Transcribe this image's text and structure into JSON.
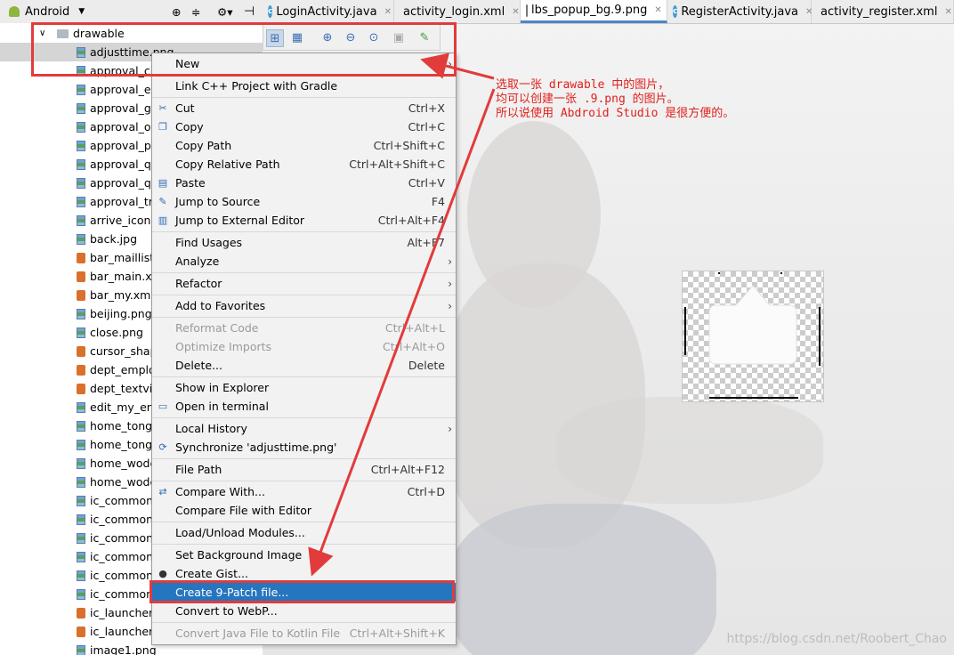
{
  "project_pane": {
    "view_label": "Android",
    "folder": "drawable",
    "files": [
      {
        "name": "adjusttime.png",
        "type": "png",
        "selected": true
      },
      {
        "name": "approval_cli",
        "type": "png"
      },
      {
        "name": "approval_en",
        "type": "png"
      },
      {
        "name": "approval_gc",
        "type": "png"
      },
      {
        "name": "approval_ov",
        "type": "png"
      },
      {
        "name": "approval_pr",
        "type": "png"
      },
      {
        "name": "approval_qi",
        "type": "png"
      },
      {
        "name": "approval_qu",
        "type": "png"
      },
      {
        "name": "approval_tra",
        "type": "png"
      },
      {
        "name": "arrive_icon.p",
        "type": "png"
      },
      {
        "name": "back.jpg",
        "type": "png"
      },
      {
        "name": "bar_maillist.:",
        "type": "xml"
      },
      {
        "name": "bar_main.xm",
        "type": "xml"
      },
      {
        "name": "bar_my.xml",
        "type": "xml"
      },
      {
        "name": "beijing.png",
        "type": "png"
      },
      {
        "name": "close.png",
        "type": "png"
      },
      {
        "name": "cursor_shap",
        "type": "xml"
      },
      {
        "name": "dept_employ",
        "type": "xml"
      },
      {
        "name": "dept_textvie",
        "type": "xml"
      },
      {
        "name": "edit_my_emp",
        "type": "png"
      },
      {
        "name": "home_tongx",
        "type": "png"
      },
      {
        "name": "home_tongx",
        "type": "png"
      },
      {
        "name": "home_wode",
        "type": "png"
      },
      {
        "name": "home_wode",
        "type": "png"
      },
      {
        "name": "ic_common_",
        "type": "png"
      },
      {
        "name": "ic_common_",
        "type": "png"
      },
      {
        "name": "ic_common_",
        "type": "png"
      },
      {
        "name": "ic_common_",
        "type": "png"
      },
      {
        "name": "ic_common_",
        "type": "png"
      },
      {
        "name": "ic_common_",
        "type": "png"
      },
      {
        "name": "ic_launcher_",
        "type": "xml"
      },
      {
        "name": "ic_launcher_",
        "type": "xml"
      },
      {
        "name": "image1.png",
        "type": "png"
      }
    ]
  },
  "tabs": [
    {
      "label": "LoginActivity.java",
      "icon": "java-class-icon"
    },
    {
      "label": "activity_login.xml",
      "icon": "xml-layout-icon"
    },
    {
      "label": "lbs_popup_bg.9.png",
      "icon": "image-file-icon",
      "active": true
    },
    {
      "label": "RegisterActivity.java",
      "icon": "java-class-icon"
    },
    {
      "label": "activity_register.xml",
      "icon": "xml-layout-icon"
    }
  ],
  "context_menu": {
    "items": [
      {
        "label": "New",
        "submenu": true
      },
      {
        "sep": true
      },
      {
        "label": "Link C++ Project with Gradle"
      },
      {
        "sep": true
      },
      {
        "label": "Cut",
        "shortcut": "Ctrl+X",
        "icon": "scissors-icon"
      },
      {
        "label": "Copy",
        "shortcut": "Ctrl+C",
        "icon": "copy-icon"
      },
      {
        "label": "Copy Path",
        "shortcut": "Ctrl+Shift+C"
      },
      {
        "label": "Copy Relative Path",
        "shortcut": "Ctrl+Alt+Shift+C"
      },
      {
        "label": "Paste",
        "shortcut": "Ctrl+V",
        "icon": "paste-icon"
      },
      {
        "label": "Jump to Source",
        "shortcut": "F4",
        "icon": "jump-source-icon"
      },
      {
        "label": "Jump to External Editor",
        "shortcut": "Ctrl+Alt+F4",
        "icon": "external-editor-icon"
      },
      {
        "sep": true
      },
      {
        "label": "Find Usages",
        "shortcut": "Alt+F7"
      },
      {
        "label": "Analyze",
        "submenu": true
      },
      {
        "sep": true
      },
      {
        "label": "Refactor",
        "submenu": true
      },
      {
        "sep": true
      },
      {
        "label": "Add to Favorites",
        "submenu": true
      },
      {
        "sep": true
      },
      {
        "label": "Reformat Code",
        "shortcut": "Ctrl+Alt+L",
        "disabled": true
      },
      {
        "label": "Optimize Imports",
        "shortcut": "Ctrl+Alt+O",
        "disabled": true
      },
      {
        "label": "Delete...",
        "shortcut": "Delete"
      },
      {
        "sep": true
      },
      {
        "label": "Show in Explorer"
      },
      {
        "label": "Open in terminal",
        "icon": "terminal-icon"
      },
      {
        "sep": true
      },
      {
        "label": "Local History",
        "submenu": true
      },
      {
        "label": "Synchronize 'adjusttime.png'",
        "icon": "sync-icon"
      },
      {
        "sep": true
      },
      {
        "label": "File Path",
        "shortcut": "Ctrl+Alt+F12"
      },
      {
        "sep": true
      },
      {
        "label": "Compare With...",
        "shortcut": "Ctrl+D",
        "icon": "compare-icon"
      },
      {
        "label": "Compare File with Editor"
      },
      {
        "sep": true
      },
      {
        "label": "Load/Unload Modules..."
      },
      {
        "sep": true
      },
      {
        "label": "Set Background Image"
      },
      {
        "label": "Create Gist...",
        "icon": "github-icon"
      },
      {
        "label": "Create 9-Patch file...",
        "highlighted": true
      },
      {
        "label": "Convert to WebP..."
      },
      {
        "sep": true
      },
      {
        "label": "Convert Java File to Kotlin File",
        "shortcut": "Ctrl+Alt+Shift+K",
        "disabled": true
      }
    ]
  },
  "annotation": {
    "text": "选取一张 drawable 中的图片，\n均可以创建一张 .9.png 的图片。\n所以说使用 Abdroid Studio 是很方便的。",
    "color": "#e0201c"
  },
  "watermark": "https://blog.csdn.net/Roobert_Chao"
}
